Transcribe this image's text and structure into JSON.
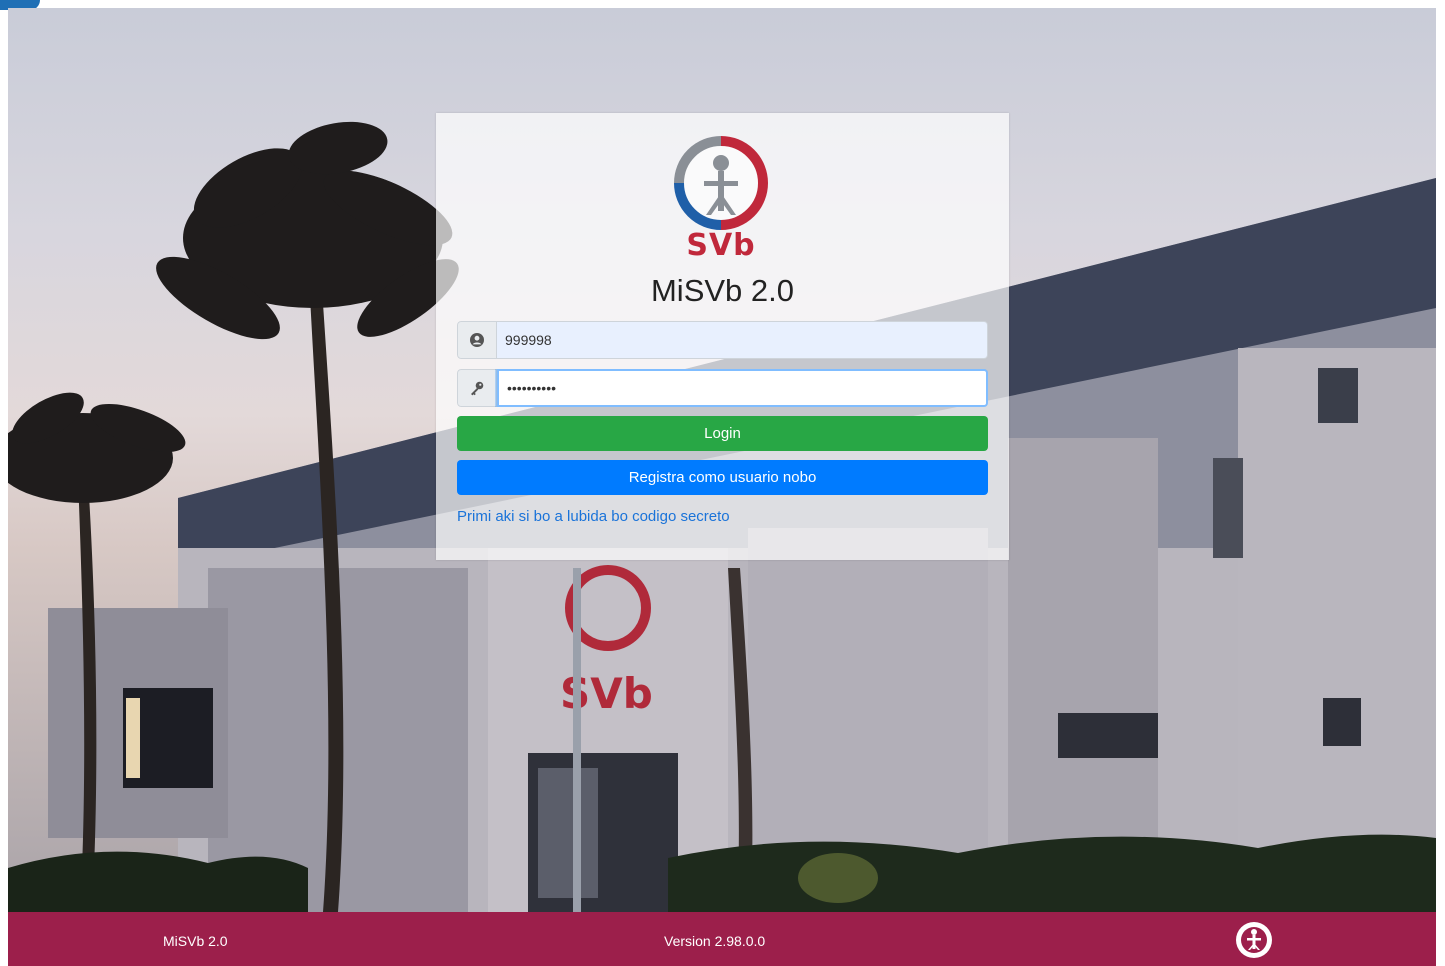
{
  "login_card": {
    "logo_text": "SVb",
    "app_title": "MiSVb 2.0",
    "username": {
      "icon": "user-circle-icon",
      "value": "999998"
    },
    "password": {
      "icon": "key-icon",
      "value": "••••••••••"
    },
    "login_label": "Login",
    "register_label": "Registra como usuario nobo",
    "forgot_link": "Primi aki si bo a lubida bo codigo secreto"
  },
  "footer": {
    "app_name": "MiSVb 2.0",
    "version": "Version 2.98.0.0",
    "emblem_icon": "svb-emblem-icon"
  },
  "colors": {
    "login": "#28a745",
    "register": "#007bff",
    "footer": "#9c1f4b",
    "brand_red": "#c0283b",
    "brand_blue": "#1f5fa8"
  }
}
